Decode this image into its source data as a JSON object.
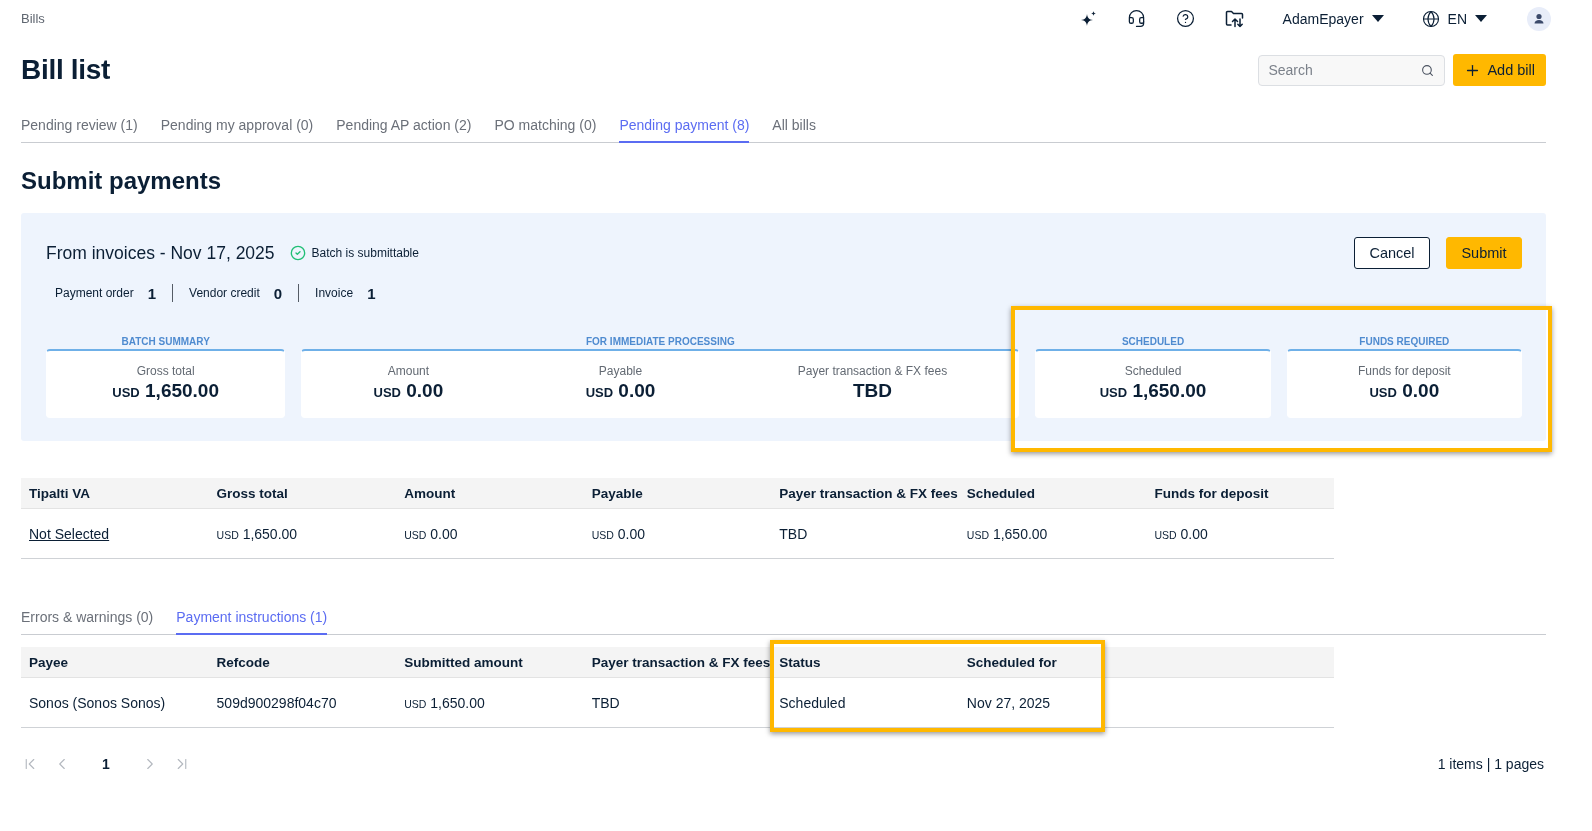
{
  "breadcrumb": "Bills",
  "header": {
    "user": "AdamEpayer",
    "language": "EN"
  },
  "title": "Bill list",
  "search": {
    "placeholder": "Search"
  },
  "add_button": "Add bill",
  "tabs": [
    {
      "label": "Pending review (1)",
      "selected": false
    },
    {
      "label": "Pending my approval (0)",
      "selected": false
    },
    {
      "label": "Pending AP action (2)",
      "selected": false
    },
    {
      "label": "PO matching (0)",
      "selected": false
    },
    {
      "label": "Pending payment (8)",
      "selected": true
    },
    {
      "label": "All bills",
      "selected": false
    }
  ],
  "section_title": "Submit payments",
  "batch": {
    "title": "From invoices - Nov 17, 2025",
    "status": "Batch is submittable",
    "counts": [
      {
        "label": "Payment order",
        "value": "1"
      },
      {
        "label": "Vendor credit",
        "value": "0"
      },
      {
        "label": "Invoice",
        "value": "1"
      }
    ],
    "buttons": [
      {
        "kind": "secondary",
        "label": "Cancel"
      },
      {
        "kind": "primary",
        "label": "Submit"
      }
    ]
  },
  "summary": {
    "sections": [
      {
        "highlighted": false,
        "groups": [
          {
            "label": "BATCH SUMMARY",
            "items": [
              {
                "label": "Gross total",
                "currency": "USD",
                "value": "1,650.00"
              }
            ]
          },
          {
            "label": "FOR IMMEDIATE PROCESSING",
            "items": [
              {
                "label": "Amount",
                "currency": "USD",
                "value": "0.00"
              },
              {
                "label": "Payable",
                "currency": "USD",
                "value": "0.00"
              },
              {
                "label": "Payer transaction & FX fees",
                "value": "TBD"
              }
            ]
          }
        ]
      },
      {
        "highlighted": true,
        "groups": [
          {
            "label": "SCHEDULED",
            "items": [
              {
                "label": "Scheduled",
                "currency": "USD",
                "value": "1,650.00"
              }
            ]
          },
          {
            "label": "FUNDS REQUIRED",
            "items": [
              {
                "label": "Funds for deposit",
                "currency": "USD",
                "value": "0.00"
              }
            ]
          }
        ]
      }
    ]
  },
  "va_table": {
    "columns": [
      "Tipalti VA",
      "Gross total",
      "Amount",
      "Payable",
      "Payer transaction & FX fees",
      "Scheduled",
      "Funds for deposit"
    ],
    "rows": [
      {
        "cells": [
          {
            "kind": "link",
            "text": "Not Selected"
          },
          {
            "kind": "money",
            "currency": "USD",
            "amount": "1,650.00"
          },
          {
            "kind": "money",
            "currency": "USD",
            "amount": "0.00"
          },
          {
            "kind": "money",
            "currency": "USD",
            "amount": "0.00"
          },
          {
            "kind": "text",
            "text": "TBD"
          },
          {
            "kind": "money",
            "currency": "USD",
            "amount": "1,650.00"
          },
          {
            "kind": "money",
            "currency": "USD",
            "amount": "0.00"
          }
        ]
      }
    ]
  },
  "detail_tabs": [
    {
      "label": "Errors & warnings (0)",
      "selected": false
    },
    {
      "label": "Payment instructions (1)",
      "selected": true
    }
  ],
  "instructions": {
    "column_groups": [
      {
        "highlighted": false,
        "columns": [
          "Payee",
          "Refcode",
          "Submitted amount",
          "Payer transaction & FX fees"
        ]
      },
      {
        "highlighted": true,
        "columns": [
          "Status",
          "Scheduled for"
        ]
      }
    ],
    "rows": [
      {
        "cells": [
          {
            "kind": "text",
            "text": "Sonos (Sonos Sonos)"
          },
          {
            "kind": "text",
            "text": "509d900298f04c70"
          },
          {
            "kind": "money",
            "currency": "USD",
            "amount": "1,650.00"
          },
          {
            "kind": "text",
            "text": "TBD"
          },
          {
            "kind": "text",
            "text": "Scheduled"
          },
          {
            "kind": "text",
            "text": "Nov 27, 2025"
          }
        ]
      }
    ]
  },
  "pagination": {
    "buttons": [
      {
        "kind": "first",
        "disabled": true
      },
      {
        "kind": "previous",
        "disabled": true
      },
      {
        "kind": "page",
        "label": "1",
        "selected": true
      },
      {
        "kind": "next",
        "disabled": true
      },
      {
        "kind": "last",
        "disabled": true
      }
    ],
    "summary": "1 items | 1 pages"
  }
}
